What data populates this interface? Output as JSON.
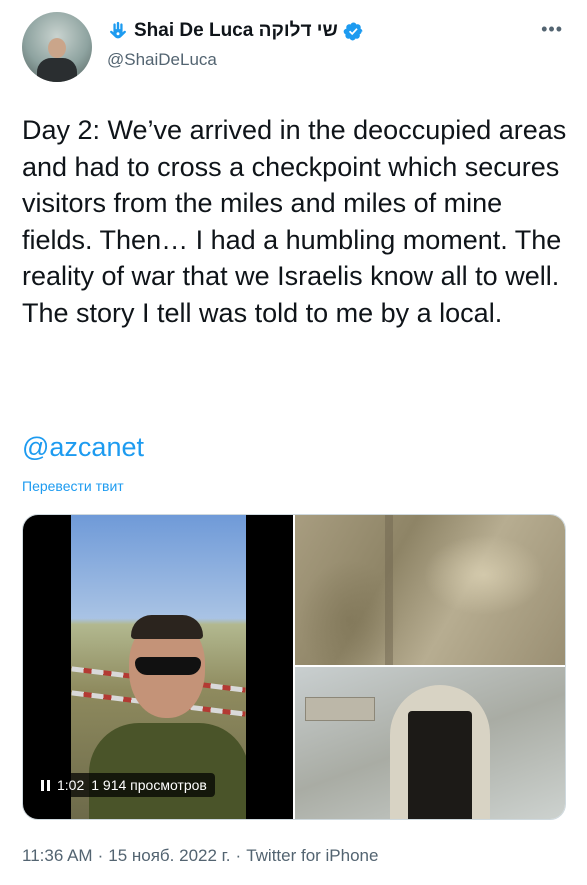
{
  "author": {
    "display_name": "Shai De Luca שי דלוקה",
    "handle": "@ShaiDeLuca",
    "verified": true,
    "badge_icon": "hamsa-icon",
    "verified_icon": "verified-badge-icon"
  },
  "tweet": {
    "text": "Day 2: We’ve arrived in the deoccupied areas and had to cross a checkpoint which secures visitors from the miles and miles of mine fields. Then… I had a humbling moment. The reality of war that we Israelis know all to well. The story I tell was told to me by a local.",
    "mention": "@azcanet",
    "translate_label": "Перевести твит"
  },
  "media": {
    "video": {
      "duration": "1:02",
      "views": "1 914 просмотров",
      "state": "paused-icon"
    },
    "photos": 2
  },
  "footer": {
    "time": "11:36 AM",
    "date": "15 нояб. 2022 г.",
    "source": "Twitter for iPhone",
    "separator": "·"
  },
  "colors": {
    "accent": "#1d9bf0",
    "secondary_text": "#536471",
    "primary_text": "#0f1419"
  }
}
